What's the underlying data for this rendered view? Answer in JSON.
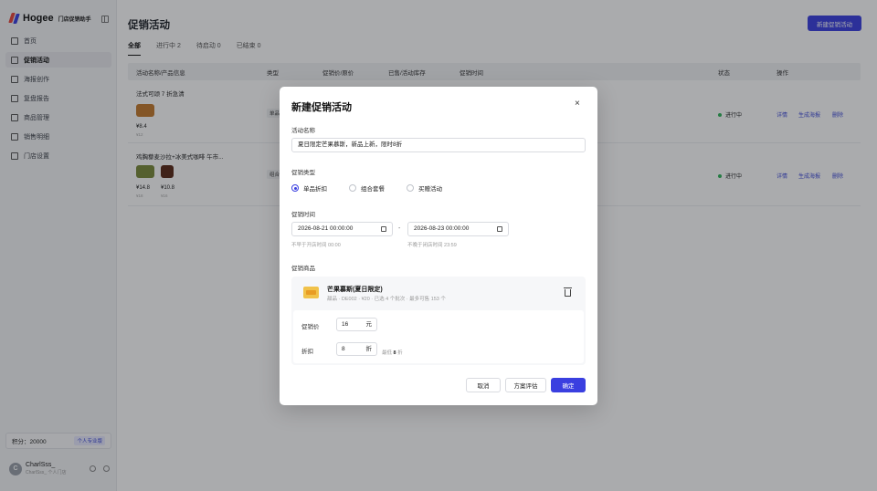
{
  "brand": {
    "name": "Hogee",
    "sub": "门店促销助手"
  },
  "sidebar": {
    "items": [
      {
        "label": "首页",
        "active": false
      },
      {
        "label": "促销活动",
        "active": true
      },
      {
        "label": "海报创作",
        "active": false
      },
      {
        "label": "复盘报告",
        "active": false
      },
      {
        "label": "商品管理",
        "active": false
      },
      {
        "label": "销售明细",
        "active": false
      },
      {
        "label": "门店设置",
        "active": false
      }
    ],
    "points_label": "积分：20000",
    "points_badge": "个人专业版",
    "user_initial": "C",
    "user_name": "CharlSss_",
    "user_sub": "CharlSss_ 个人门店"
  },
  "main": {
    "title": "促销活动",
    "new_button": "新建促销活动",
    "tabs": [
      {
        "label": "全部",
        "active": true
      },
      {
        "label": "进行中 2",
        "active": false
      },
      {
        "label": "待启动 0",
        "active": false
      },
      {
        "label": "已结束 0",
        "active": false
      }
    ],
    "columns": [
      "活动名称/产品信息",
      "类型",
      "促销价/原价",
      "已售/活动库存",
      "促销时间",
      "状态",
      "操作"
    ],
    "rows": [
      {
        "title": "法式可颂 7 折急清",
        "type": "单品",
        "prices": [
          {
            "price": "¥8.4",
            "orig": "¥12"
          }
        ],
        "status": "进行中",
        "ops": [
          "详情",
          "生成海报",
          "删除"
        ]
      },
      {
        "title": "鸡胸藜麦沙拉+冰美式咖啡 午市...",
        "type": "组合",
        "prices": [
          {
            "price": "¥14.8",
            "orig": "¥18"
          },
          {
            "price": "¥10.8",
            "orig": "¥16"
          }
        ],
        "status": "进行中",
        "ops": [
          "详情",
          "生成海报",
          "删除"
        ]
      }
    ]
  },
  "modal": {
    "title": "新建促销活动",
    "close": "×",
    "name_label": "活动名称",
    "name_value": "夏日限定芒果慕斯，新品上新，限时8折",
    "type_label": "促销类型",
    "types": [
      {
        "label": "单品折扣",
        "checked": true
      },
      {
        "label": "组合套餐",
        "checked": false
      },
      {
        "label": "买赠活动",
        "checked": false
      }
    ],
    "time_label": "促销时间",
    "start_value": "2026-08-21 00:00:00",
    "end_value": "2026-08-23 00:00:00",
    "date_sep": "-",
    "start_hint": "不早于开店时间 00:00",
    "end_hint": "不晚于闭店时间 23:59",
    "product_label": "促销商品",
    "product_name": "芒果慕斯(夏日限定)",
    "product_meta": "甜品 · DE002 · ¥20 · 已选 4 个批次 · 最多可售 153 个",
    "price_label": "促销价",
    "price_value": "16",
    "price_unit": "元",
    "discount_label": "折扣",
    "discount_value": "8",
    "discount_unit": "折",
    "discount_hint_prefix": "最低",
    "discount_hint_value": "8",
    "discount_hint_suffix": "折",
    "cancel": "取消",
    "evaluate": "方案评估",
    "confirm": "确定"
  },
  "colors": {
    "accent": "#3a3fe0",
    "status_green": "#2fb45a"
  }
}
